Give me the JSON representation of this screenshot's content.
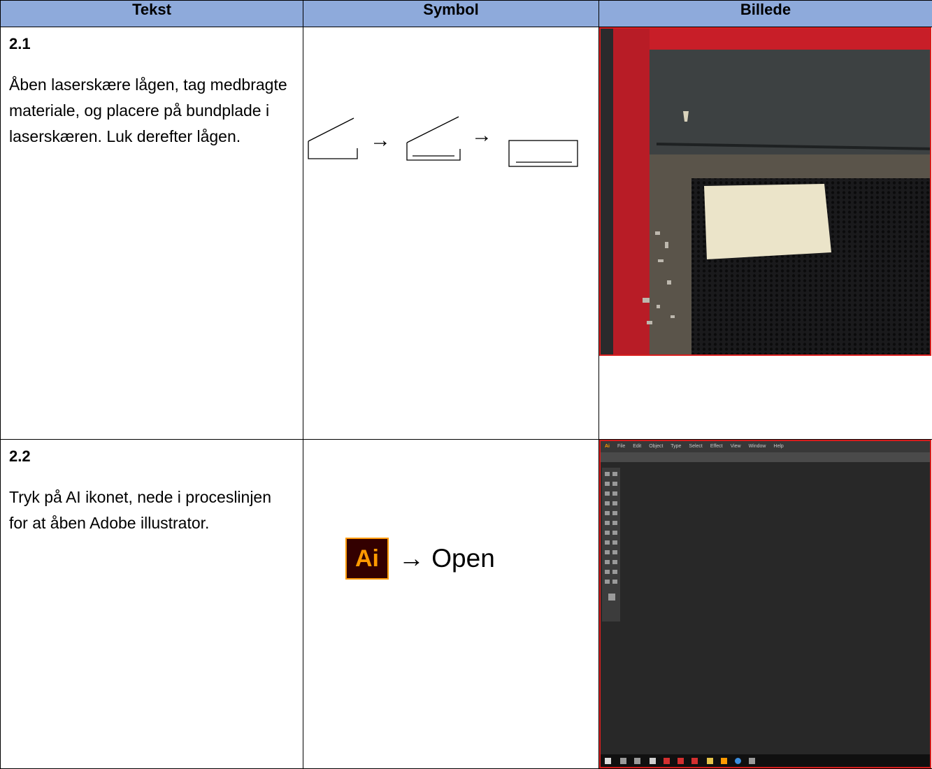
{
  "table": {
    "headers": [
      "Tekst",
      "Symbol",
      "Billede"
    ],
    "rows": [
      {
        "step": "2.1",
        "text": "Åben laserskære lågen, tag medbragte materiale, og placere på bundplade i laserskæren. Luk derefter lågen.",
        "symbol": {
          "arrow": "→"
        }
      },
      {
        "step": "2.2",
        "text": "Tryk på AI ikonet, nede i proceslinjen for at åben Adobe illustrator.",
        "symbol": {
          "logo_text": "Ai",
          "arrow_label": "→ Open"
        }
      }
    ]
  },
  "illustrator_menu": [
    "Ai",
    "File",
    "Edit",
    "Object",
    "Type",
    "Select",
    "Effect",
    "View",
    "Window",
    "Help"
  ],
  "colors": {
    "header_bg": "#8eaadb",
    "photo_border": "#d81e1e",
    "ai_orange": "#ff9a00",
    "ai_dark": "#330000"
  }
}
